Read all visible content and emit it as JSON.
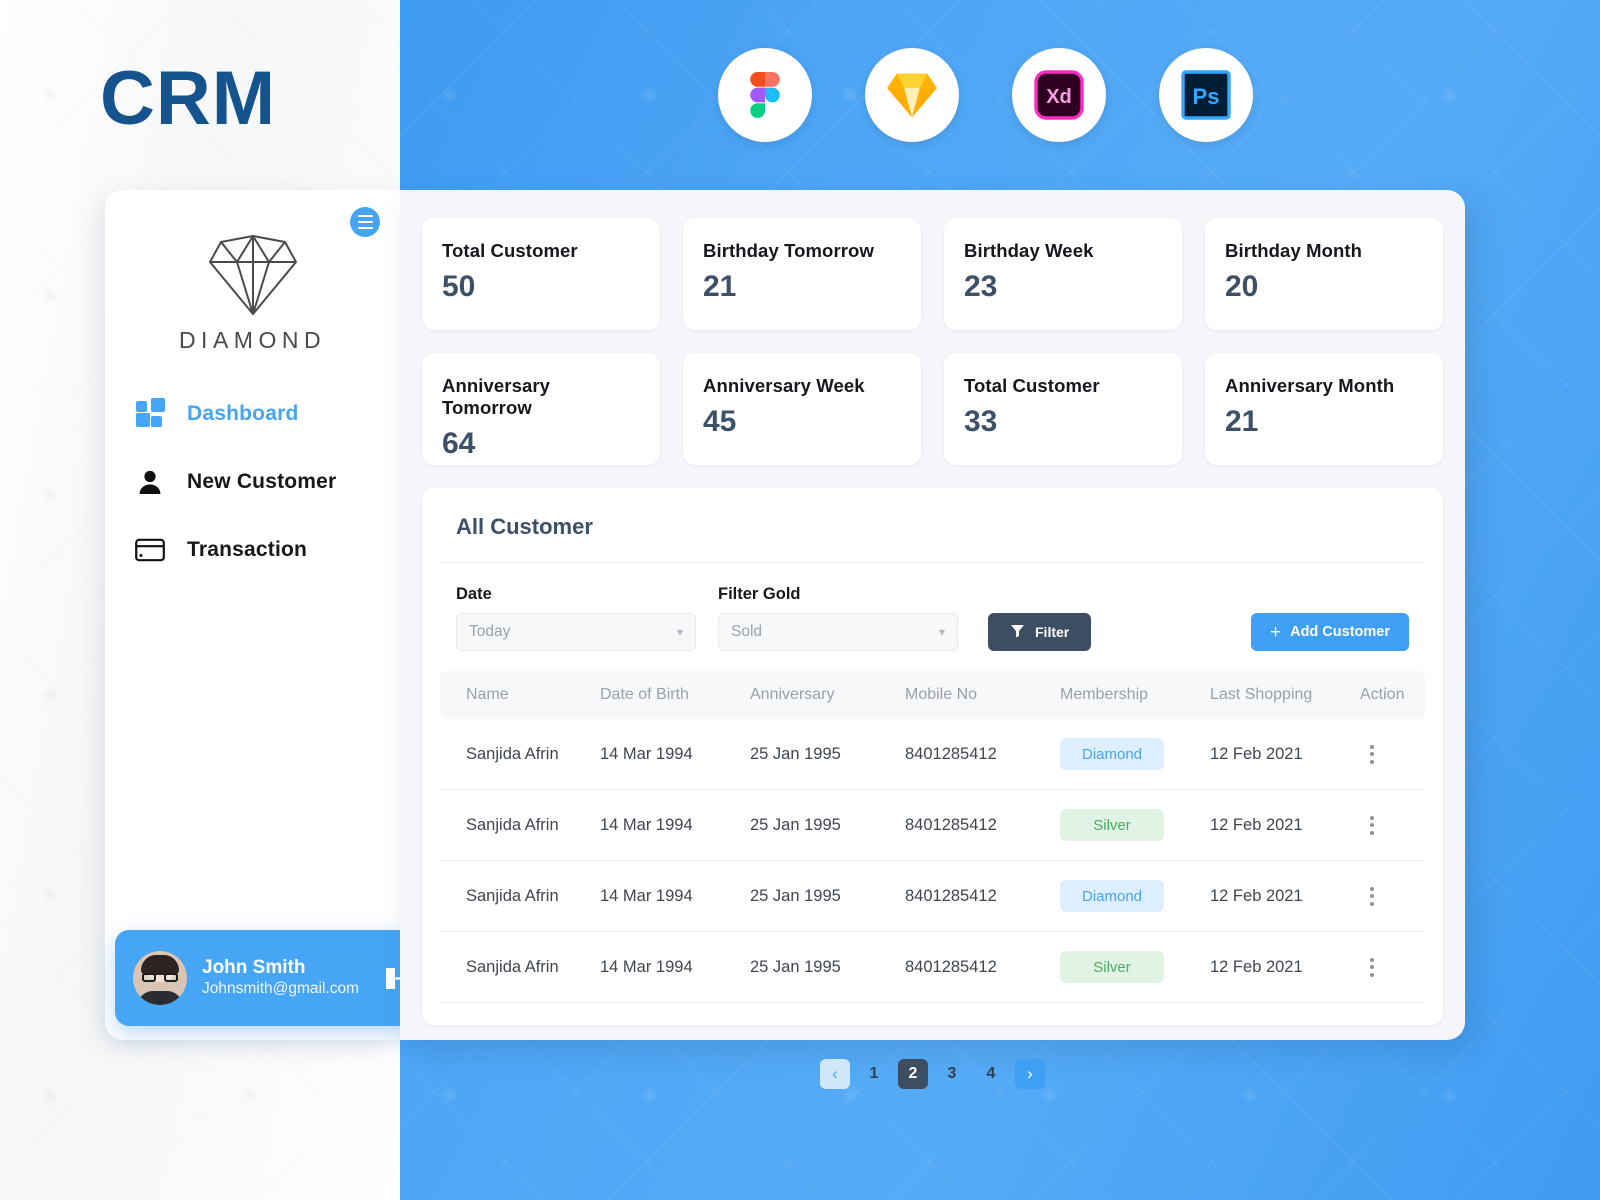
{
  "brand": {
    "title": "CRM"
  },
  "tools": [
    {
      "name": "figma-icon",
      "label": "Figma"
    },
    {
      "name": "sketch-icon",
      "label": "Sketch"
    },
    {
      "name": "adobe-xd-icon",
      "label": "Xd"
    },
    {
      "name": "photoshop-icon",
      "label": "Ps"
    }
  ],
  "sidebar": {
    "logo_word": "DIAMOND",
    "items": [
      {
        "label": "Dashboard",
        "icon": "grid-icon",
        "active": true
      },
      {
        "label": "New Customer",
        "icon": "user-icon",
        "active": false
      },
      {
        "label": "Transaction",
        "icon": "credit-card-icon",
        "active": false
      }
    ],
    "profile": {
      "name": "John Smith",
      "email": "Johnsmith@gmail.com",
      "logout_icon": "logout-icon"
    }
  },
  "stats": [
    {
      "label": "Total Customer",
      "value": "50"
    },
    {
      "label": "Birthday Tomorrow",
      "value": "21"
    },
    {
      "label": "Birthday Week",
      "value": "23"
    },
    {
      "label": "Birthday Month",
      "value": "20"
    },
    {
      "label": "Anniversary Tomorrow",
      "value": "64"
    },
    {
      "label": "Anniversary Week",
      "value": "45"
    },
    {
      "label": "Total Customer",
      "value": "33"
    },
    {
      "label": "Anniversary Month",
      "value": "21"
    }
  ],
  "panel": {
    "title": "All Customer",
    "filters": {
      "date_label": "Date",
      "date_value": "Today",
      "gold_label": "Filter Gold",
      "gold_value": "Sold",
      "filter_button": "Filter",
      "add_button": "Add Customer"
    },
    "columns": [
      "Name",
      "Date of Birth",
      "Anniversary",
      "Mobile No",
      "Membership",
      "Last Shopping",
      "Action"
    ],
    "rows": [
      {
        "name": "Sanjida Afrin",
        "dob": "14 Mar 1994",
        "anniversary": "25 Jan 1995",
        "mobile": "8401285412",
        "membership": "Diamond",
        "membership_type": "diamond",
        "last_shopping": "12 Feb 2021"
      },
      {
        "name": "Sanjida Afrin",
        "dob": "14 Mar 1994",
        "anniversary": "25 Jan 1995",
        "mobile": "8401285412",
        "membership": "Silver",
        "membership_type": "silver",
        "last_shopping": "12 Feb 2021"
      },
      {
        "name": "Sanjida Afrin",
        "dob": "14 Mar 1994",
        "anniversary": "25 Jan 1995",
        "mobile": "8401285412",
        "membership": "Diamond",
        "membership_type": "diamond",
        "last_shopping": "12 Feb 2021"
      },
      {
        "name": "Sanjida Afrin",
        "dob": "14 Mar 1994",
        "anniversary": "25 Jan 1995",
        "mobile": "8401285412",
        "membership": "Silver",
        "membership_type": "silver",
        "last_shopping": "12 Feb 2021"
      }
    ],
    "pagination": {
      "prev": "‹",
      "pages": [
        "1",
        "2",
        "3",
        "4"
      ],
      "active": "2",
      "next": "›"
    }
  },
  "colors": {
    "accent_blue": "#46a5f5",
    "brand_navy": "#15538f",
    "slate": "#3d4d62",
    "value_slate": "#3c5068",
    "badge_diamond_bg": "#ddeeff",
    "badge_diamond_text": "#46a5f5",
    "badge_silver_bg": "#e1f3e5",
    "badge_silver_text": "#4cae62"
  }
}
